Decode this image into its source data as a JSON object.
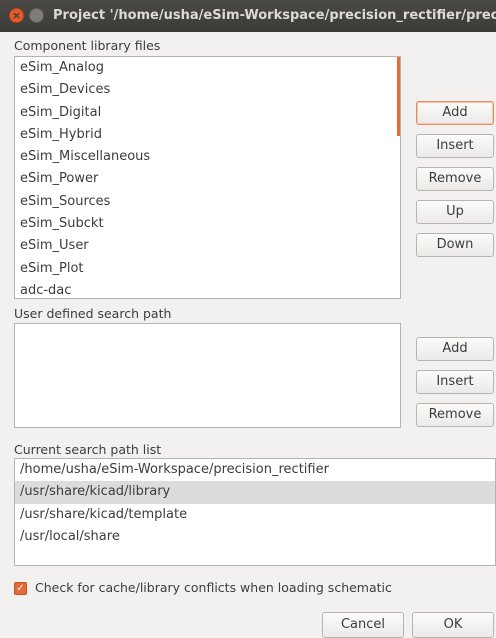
{
  "window": {
    "title": "Project '/home/usha/eSim-Workspace/precision_rectifier/precision_rectifier'"
  },
  "component_library": {
    "label": "Component library files",
    "items": [
      "eSim_Analog",
      "eSim_Devices",
      "eSim_Digital",
      "eSim_Hybrid",
      "eSim_Miscellaneous",
      "eSim_Power",
      "eSim_Sources",
      "eSim_Subckt",
      "eSim_User",
      "eSim_Plot",
      "adc-dac"
    ],
    "buttons": {
      "add": "Add",
      "insert": "Insert",
      "remove": "Remove",
      "up": "Up",
      "down": "Down"
    }
  },
  "user_search_path": {
    "label": "User defined search path",
    "buttons": {
      "add": "Add",
      "insert": "Insert",
      "remove": "Remove"
    }
  },
  "current_search_path": {
    "label": "Current search path list",
    "items": [
      "/home/usha/eSim-Workspace/precision_rectifier",
      "/usr/share/kicad/library",
      "/usr/share/kicad/template",
      "/usr/local/share"
    ],
    "selected_index": 1
  },
  "options": {
    "check_conflicts_label": "Check for cache/library conflicts when loading schematic",
    "check_conflicts_checked": true
  },
  "dialog_buttons": {
    "cancel": "Cancel",
    "ok": "OK"
  },
  "colors": {
    "accent": "#e56a35",
    "titlebar": "#3c3b37"
  }
}
